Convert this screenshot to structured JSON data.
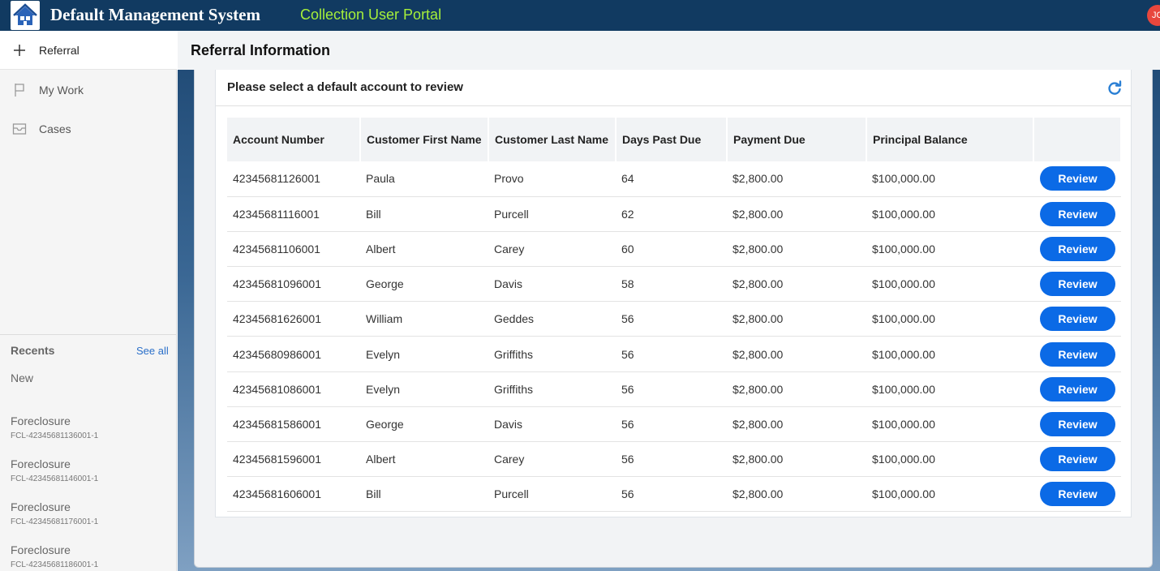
{
  "header": {
    "app_title": "Default Management System",
    "portal_title": "Collection User Portal",
    "avatar_initials": "JC",
    "logo_icon": "home-icon",
    "colors": {
      "bar": "#113a61",
      "portal_title": "#a6f03a",
      "avatar": "#e8473d"
    }
  },
  "sidebar": {
    "nav": [
      {
        "label": "Referral",
        "icon": "plus-icon"
      },
      {
        "label": "My Work",
        "icon": "flag-icon"
      },
      {
        "label": "Cases",
        "icon": "inbox-icon"
      }
    ],
    "recents": {
      "title": "Recents",
      "see_all": "See all",
      "new_label": "New",
      "items": [
        {
          "title": "Foreclosure",
          "subtitle": "FCL-42345681136001-1"
        },
        {
          "title": "Foreclosure",
          "subtitle": "FCL-42345681146001-1"
        },
        {
          "title": "Foreclosure",
          "subtitle": "FCL-42345681176001-1"
        },
        {
          "title": "Foreclosure",
          "subtitle": "FCL-42345681186001-1"
        }
      ]
    }
  },
  "main": {
    "page_title": "Referral Information",
    "card_title": "Please select a default account to review",
    "refresh_icon": "refresh-icon",
    "table": {
      "columns": [
        "Account Number",
        "Customer First Name",
        "Customer Last Name",
        "Days Past Due",
        "Payment Due",
        "Principal Balance",
        ""
      ],
      "action_label": "Review",
      "rows": [
        [
          "42345681126001",
          "Paula",
          "Provo",
          "64",
          "$2,800.00",
          "$100,000.00"
        ],
        [
          "42345681116001",
          "Bill",
          "Purcell",
          "62",
          "$2,800.00",
          "$100,000.00"
        ],
        [
          "42345681106001",
          "Albert",
          "Carey",
          "60",
          "$2,800.00",
          "$100,000.00"
        ],
        [
          "42345681096001",
          "George",
          "Davis",
          "58",
          "$2,800.00",
          "$100,000.00"
        ],
        [
          "42345681626001",
          "William",
          "Geddes",
          "56",
          "$2,800.00",
          "$100,000.00"
        ],
        [
          "42345680986001",
          "Evelyn",
          "Griffiths",
          "56",
          "$2,800.00",
          "$100,000.00"
        ],
        [
          "42345681086001",
          "Evelyn",
          "Griffiths",
          "56",
          "$2,800.00",
          "$100,000.00"
        ],
        [
          "42345681586001",
          "George",
          "Davis",
          "56",
          "$2,800.00",
          "$100,000.00"
        ],
        [
          "42345681596001",
          "Albert",
          "Carey",
          "56",
          "$2,800.00",
          "$100,000.00"
        ],
        [
          "42345681606001",
          "Bill",
          "Purcell",
          "56",
          "$2,800.00",
          "$100,000.00"
        ]
      ]
    },
    "colors": {
      "button": "#0b6ae6",
      "link": "#2a6fc9"
    }
  }
}
